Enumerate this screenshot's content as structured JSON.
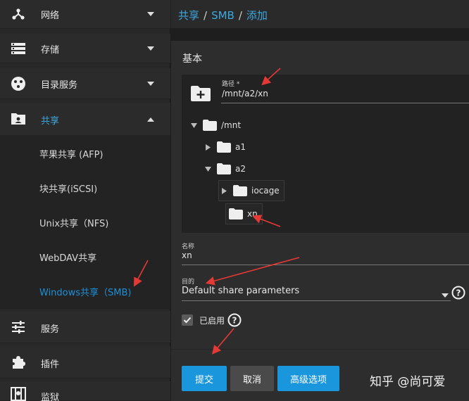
{
  "sidebar": {
    "items": [
      {
        "label": "网络",
        "icon": "network-icon"
      },
      {
        "label": "存储",
        "icon": "storage-icon"
      },
      {
        "label": "目录服务",
        "icon": "directory-services-icon"
      },
      {
        "label": "共享",
        "icon": "sharing-icon"
      },
      {
        "label": "服务",
        "icon": "services-icon"
      },
      {
        "label": "插件",
        "icon": "plugins-icon"
      },
      {
        "label": "监狱",
        "icon": "jails-icon"
      }
    ],
    "sub_items": [
      {
        "label": "苹果共享 (AFP)"
      },
      {
        "label": "块共享(iSCSI)"
      },
      {
        "label": "Unix共享（NFS)"
      },
      {
        "label": "WebDAV共享"
      },
      {
        "label": "Windows共享（SMB)"
      }
    ]
  },
  "breadcrumb": {
    "part1": "共享",
    "part2": "SMB",
    "part3": "添加",
    "separator": "/"
  },
  "form": {
    "section_title": "基本",
    "path": {
      "label": "路径 *",
      "value": "/mnt/a2/xn"
    },
    "tree": {
      "root": "/mnt",
      "a1": "a1",
      "a2": "a2",
      "iocage": "iocage",
      "xn": "xn"
    },
    "name": {
      "label": "名称",
      "value": "xn"
    },
    "purpose": {
      "label": "目的",
      "value": "Default share parameters"
    },
    "enabled": {
      "label": "已启用",
      "checked": true
    },
    "buttons": {
      "submit": "提交",
      "cancel": "取消",
      "advanced": "高级选项"
    }
  },
  "watermark": "知乎 @尚可爱",
  "colors": {
    "accent": "#1a96dd",
    "link": "#3da8e0",
    "annotation": "#e53935"
  }
}
